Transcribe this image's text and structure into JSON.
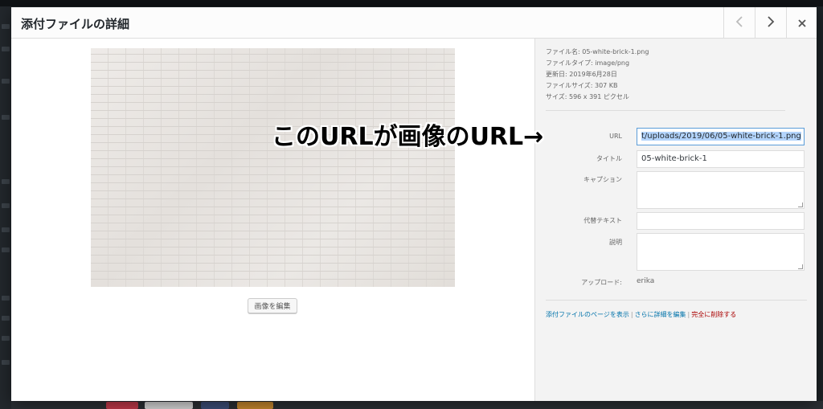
{
  "modal": {
    "title": "添付ファイルの詳細",
    "prev_icon": "chevron-left-icon",
    "next_icon": "chevron-right-icon",
    "close_icon": "close-icon"
  },
  "preview": {
    "edit_button": "画像を編集"
  },
  "details": {
    "file_name": "ファイル名: 05-white-brick-1.png",
    "file_type": "ファイルタイプ: image/png",
    "updated": "更新日: 2019年6月28日",
    "file_size": "ファイルサイズ: 307 KB",
    "dimensions": "サイズ: 596 x 391 ピクセル"
  },
  "fields": {
    "url_label": "URL",
    "url_value": "t/uploads/2019/06/05-white-brick-1.png",
    "title_label": "タイトル",
    "title_value": "05-white-brick-1",
    "caption_label": "キャプション",
    "caption_value": "",
    "alt_label": "代替テキスト",
    "alt_value": "",
    "description_label": "説明",
    "description_value": "",
    "uploader_label": "アップロード:",
    "uploader_value": "erika"
  },
  "actions": {
    "view_page": "添付ファイルのページを表示",
    "edit_more": "さらに詳細を編集",
    "delete": "完全に削除する",
    "separator": "|"
  },
  "annotation": {
    "text": "このURLが画像のURL→"
  },
  "colors": {
    "link": "#0073aa",
    "danger": "#a00000",
    "selection": "#b3d4fc"
  }
}
